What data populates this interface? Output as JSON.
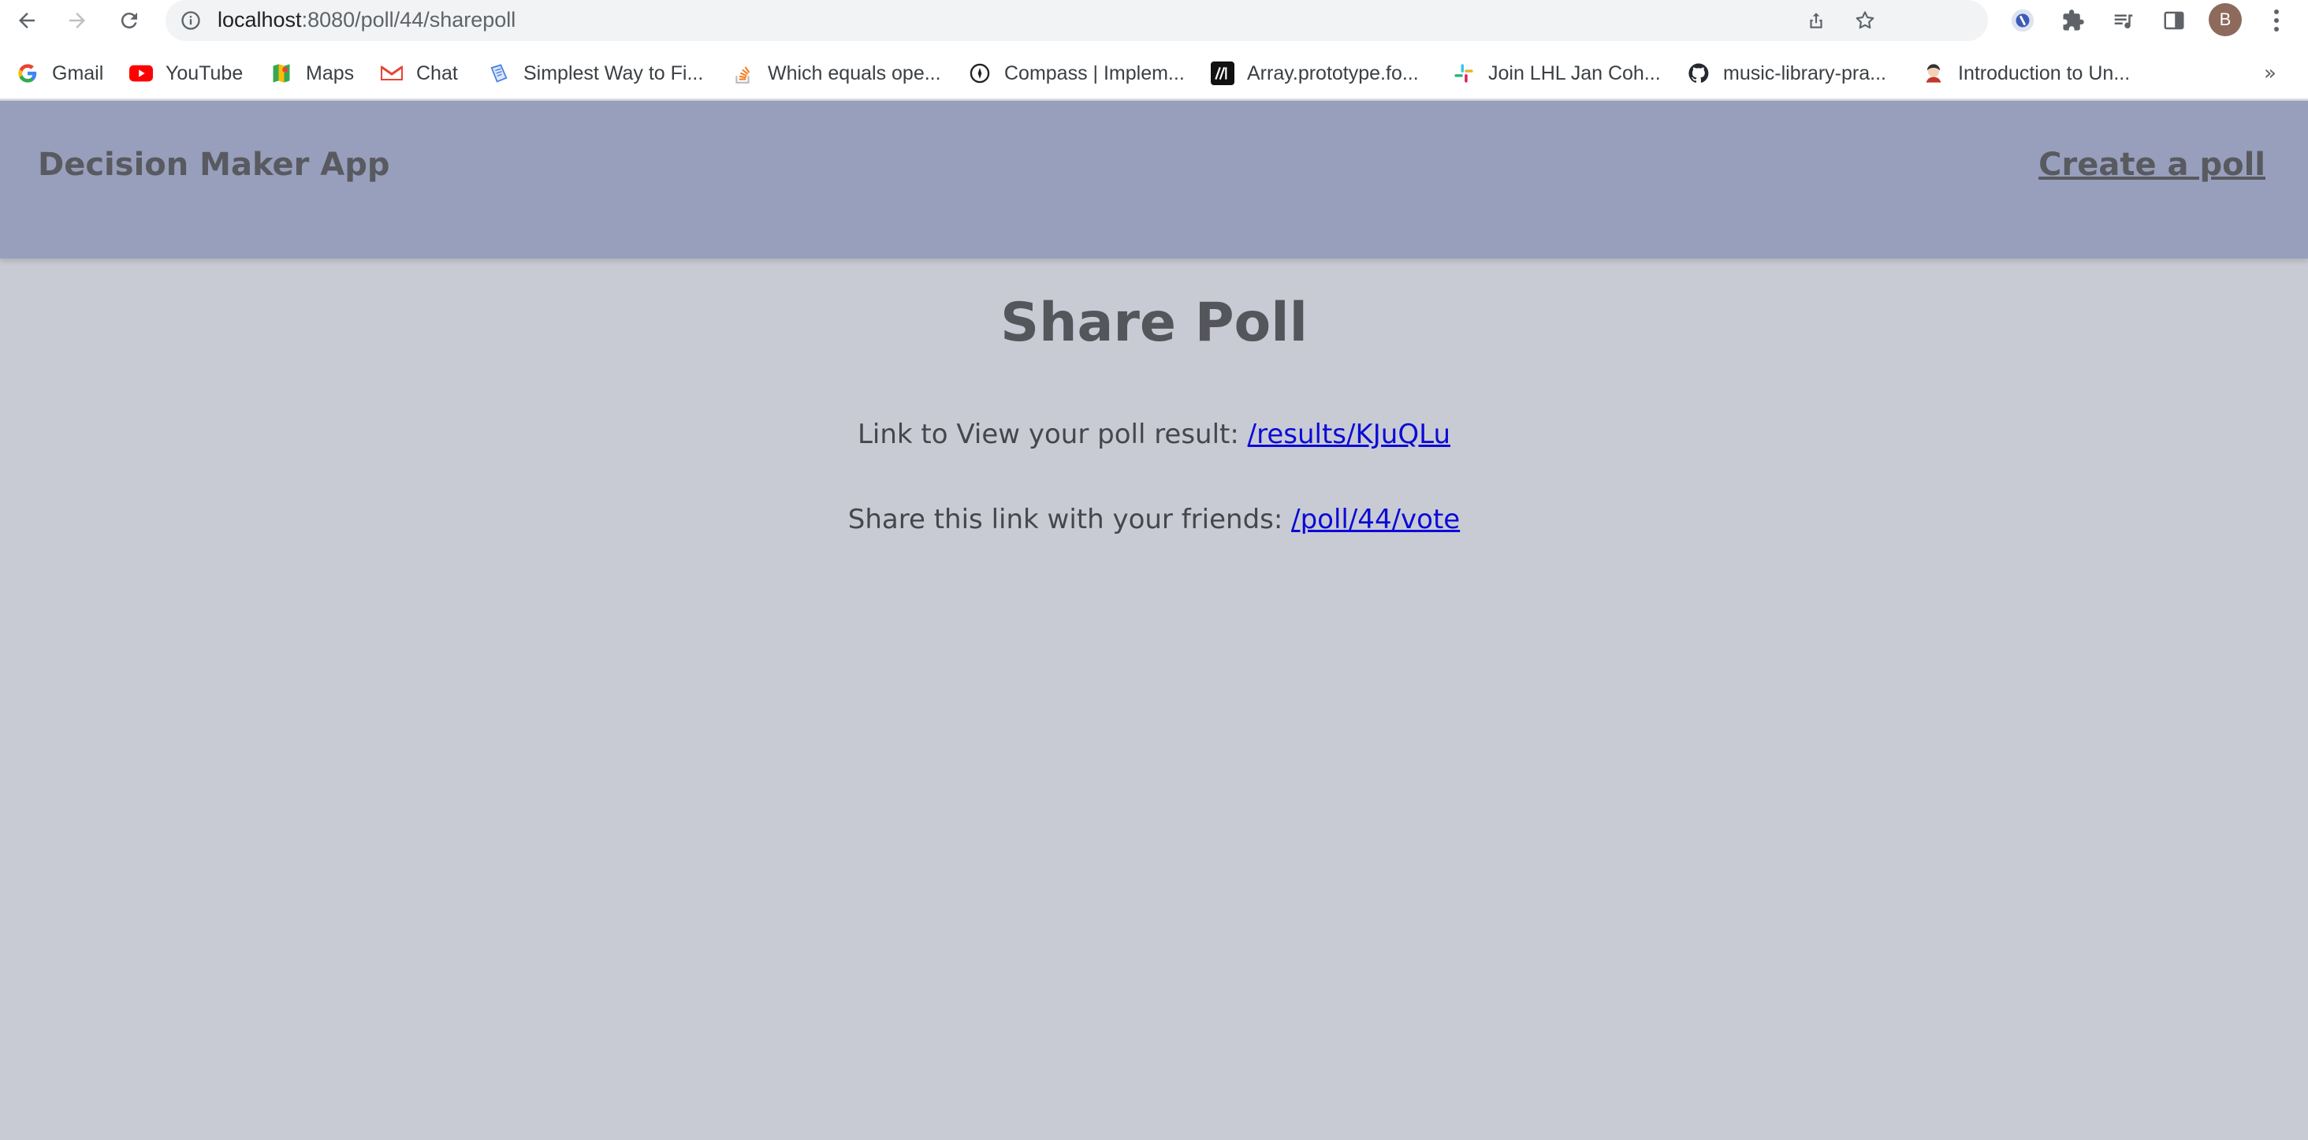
{
  "browser": {
    "url_host": "localhost",
    "url_path": ":8080/poll/44/sharepoll",
    "avatar_letter": "B",
    "bookmarks": [
      {
        "label": "Gmail",
        "icon": "google-icon"
      },
      {
        "label": "YouTube",
        "icon": "youtube-icon"
      },
      {
        "label": "Maps",
        "icon": "maps-icon"
      },
      {
        "label": "Chat",
        "icon": "gmail-icon"
      },
      {
        "label": "Simplest Way to Fi...",
        "icon": "doc-icon"
      },
      {
        "label": "Which equals ope...",
        "icon": "stackoverflow-icon"
      },
      {
        "label": "Compass | Implem...",
        "icon": "compass-icon"
      },
      {
        "label": "Array.prototype.fo...",
        "icon": "mdn-icon"
      },
      {
        "label": "Join LHL Jan Coh...",
        "icon": "slack-icon"
      },
      {
        "label": "music-library-pra...",
        "icon": "github-icon"
      },
      {
        "label": "Introduction to Un...",
        "icon": "avatar-icon"
      }
    ],
    "bookmarks_more": "»"
  },
  "navbar": {
    "brand": "Decision Maker App",
    "create_link": "Create a poll"
  },
  "main": {
    "title": "Share Poll",
    "results_label": "Link to View your poll result: ",
    "results_link": "/results/KJuQLu",
    "share_label": "Share this link with your friends: ",
    "share_link": "/poll/44/vote"
  },
  "colors": {
    "page_bg": "#c9cbd4",
    "navbar_bg": "#989fbc",
    "link": "#0b0bd6",
    "heading": "#54565c"
  }
}
